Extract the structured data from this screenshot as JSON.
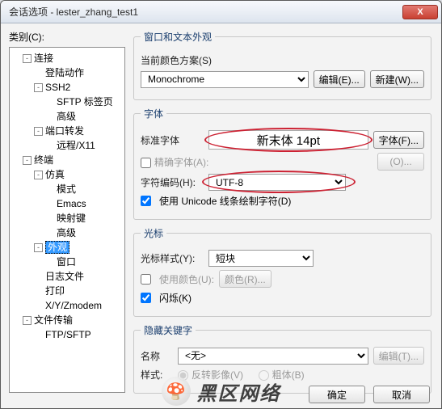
{
  "window": {
    "title": "会话选项 - lester_zhang_test1"
  },
  "left": {
    "label": "类别(C):",
    "tree": {
      "n0": "连接",
      "n0_0": "登陆动作",
      "n0_1": "SSH2",
      "n0_1_0": "SFTP 标签页",
      "n0_1_1": "高级",
      "n0_2": "端口转发",
      "n0_2_0": "远程/X11",
      "n1": "终端",
      "n1_0": "仿真",
      "n1_0_0": "模式",
      "n1_0_1": "Emacs",
      "n1_0_2": "映射键",
      "n1_0_3": "高级",
      "n1_1": "外观",
      "n1_1_0": "窗口",
      "n1_2": "日志文件",
      "n1_3": "打印",
      "n1_4": "X/Y/Zmodem",
      "n2": "文件传输",
      "n2_0": "FTP/SFTP"
    }
  },
  "panel": {
    "group1": {
      "legend": "窗口和文本外观",
      "scheme_label": "当前颜色方案(S)",
      "scheme_value": "Monochrome",
      "edit_btn": "编辑(E)...",
      "new_btn": "新建(W)..."
    },
    "group2": {
      "legend": "字体",
      "std_label": "标准字体",
      "font_display": "新末体  14pt",
      "font_btn": "字体(F)...",
      "precise_label": "精确字体(A):",
      "precise_btn": "(O)...",
      "enc_label": "字符编码(H):",
      "enc_value": "UTF-8",
      "unicode_label": "使用 Unicode 线条绘制字符(D)"
    },
    "group3": {
      "legend": "光标",
      "style_label": "光标样式(Y):",
      "style_value": "短块",
      "usecolor_label": "使用颜色(U):",
      "color_btn": "颜色(R)...",
      "blink_label": "闪烁(K)"
    },
    "group4": {
      "legend": "隐藏关键字",
      "name_label": "名称",
      "name_value": "<无>",
      "edit_btn": "编辑(T)...",
      "style_label": "样式:",
      "opt1": "反转影像(V)",
      "opt2": "粗体(B)"
    },
    "footer": {
      "ok": "确定",
      "cancel": "取消"
    }
  },
  "watermark": {
    "text": "黑区网络"
  }
}
